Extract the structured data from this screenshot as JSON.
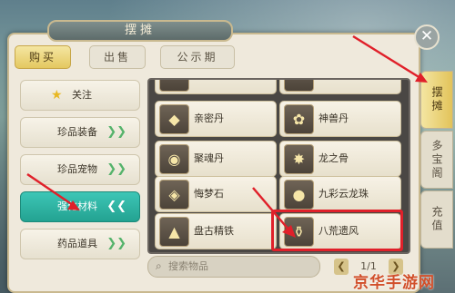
{
  "window": {
    "title": "摆摊",
    "close_glyph": "✕"
  },
  "tabs": [
    {
      "label": "购买",
      "active": true
    },
    {
      "label": "出售",
      "active": false
    },
    {
      "label": "公示期",
      "active": false
    }
  ],
  "sidebar": {
    "items": [
      {
        "label": "关注",
        "chevron": ""
      },
      {
        "label": "珍品装备",
        "chevron": "❯❯"
      },
      {
        "label": "珍品宠物",
        "chevron": "❯❯"
      },
      {
        "label": "强化材料",
        "chevron": "❮❮",
        "active": true
      },
      {
        "label": "药品道具",
        "chevron": "❯❯"
      }
    ]
  },
  "items": [
    {
      "name": "亲密丹",
      "icon": "◆"
    },
    {
      "name": "神兽丹",
      "icon": "✿"
    },
    {
      "name": "聚魂丹",
      "icon": "◉"
    },
    {
      "name": "龙之骨",
      "icon": "✸"
    },
    {
      "name": "悔梦石",
      "icon": "◈"
    },
    {
      "name": "九彩云龙珠",
      "icon": "●"
    },
    {
      "name": "盘古精铁",
      "icon": "▲"
    },
    {
      "name": "八荒遗风",
      "icon": "⚱"
    }
  ],
  "search": {
    "placeholder": "搜索物品",
    "icon": "⌕"
  },
  "pager": {
    "text": "1/1",
    "prev": "❮",
    "next": "❯"
  },
  "right_tabs": [
    {
      "label": "摆摊",
      "active": true
    },
    {
      "label": "多宝阁",
      "active": false
    },
    {
      "label": "充值",
      "active": false
    }
  ],
  "watermark": "京华手游网",
  "colors": {
    "accent_teal": "#23a291",
    "highlight_red": "#e0202a",
    "gold": "#e4c860"
  }
}
